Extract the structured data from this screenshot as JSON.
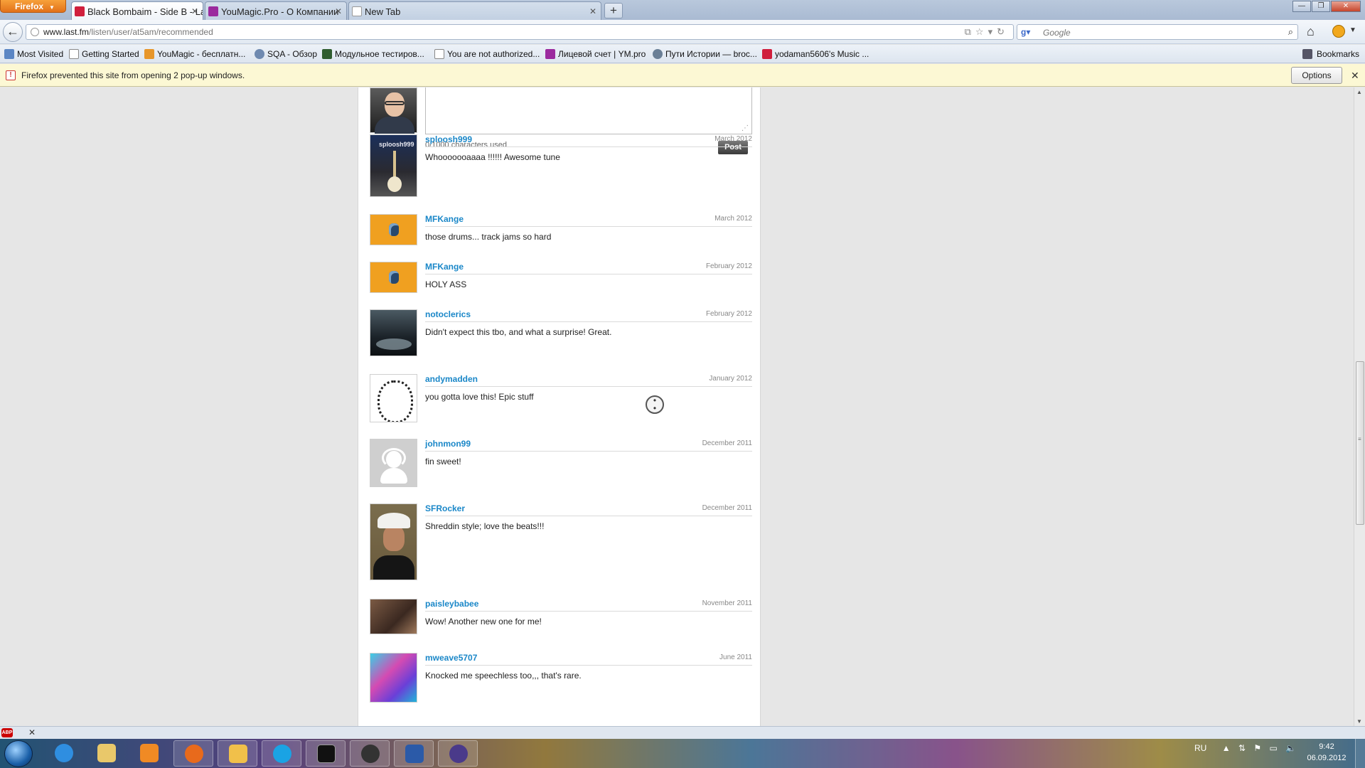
{
  "browser": {
    "menu_button": "Firefox",
    "tabs": [
      {
        "title": "Black Bombaim - Side B - Last.fm",
        "active": true,
        "color": "#d01f3c"
      },
      {
        "title": "YouMagic.Pro - О Компании",
        "active": false,
        "color": "#9b2a9e"
      },
      {
        "title": "New Tab",
        "active": false,
        "color": "#ffffff"
      }
    ],
    "url_host": "www.last.fm",
    "url_path": "/listen/user/at5am/recommended",
    "search_placeholder": "Google",
    "bookmarks": [
      {
        "label": "Most Visited",
        "icon": "star-icon"
      },
      {
        "label": "Getting Started",
        "icon": "page-icon"
      },
      {
        "label": "YouMagic - бесплатн...",
        "icon": "youmagic-icon"
      },
      {
        "label": "SQA - Обзор",
        "icon": "sqa-icon"
      },
      {
        "label": "Модульное тестиров...",
        "icon": "grid-icon"
      },
      {
        "label": "You are not authorized...",
        "icon": "page-icon"
      },
      {
        "label": "Лицевой счет | YM.pro",
        "icon": "youmagic-icon"
      },
      {
        "label": "Пути Истории — broc...",
        "icon": "globe-icon"
      },
      {
        "label": "yodaman5606's Music ...",
        "icon": "lastfm-icon"
      }
    ],
    "bookmarks_menu": "Bookmarks",
    "notification": "Firefox prevented this site from opening 2 pop-up windows.",
    "notification_button": "Options"
  },
  "shoutbox": {
    "char_count": "0/1000 characters used",
    "post_label": "Post",
    "comments": [
      {
        "user": "sploosh999",
        "date": "March 2012",
        "text": "Whooooooaaaa !!!!!! Awesome tune",
        "avatar_label": "sploosh999"
      },
      {
        "user": "MFKange",
        "date": "March 2012",
        "text": "those drums... track jams so hard"
      },
      {
        "user": "MFKange",
        "date": "February 2012",
        "text": "HOLY ASS"
      },
      {
        "user": "notoclerics",
        "date": "February 2012",
        "text": "Didn't expect this tbo, and what a surprise! Great."
      },
      {
        "user": "andymadden",
        "date": "January 2012",
        "text": "you gotta love this! Epic stuff"
      },
      {
        "user": "johnmon99",
        "date": "December 2011",
        "text": "fin sweet!"
      },
      {
        "user": "SFRocker",
        "date": "December 2011",
        "text": "Shreddin style; love the beats!!!"
      },
      {
        "user": "paisleybabee",
        "date": "November 2011",
        "text": "Wow! Another new one for me!"
      },
      {
        "user": "mweave5707",
        "date": "June 2011",
        "text": "Knocked me speechless too,,, that's rare."
      }
    ]
  },
  "colors": {
    "username_link": "#1a87c8",
    "firefox_orange": "#e2711a"
  },
  "taskbar": {
    "language": "RU",
    "time": "9:42",
    "date": "06.09.2012"
  }
}
